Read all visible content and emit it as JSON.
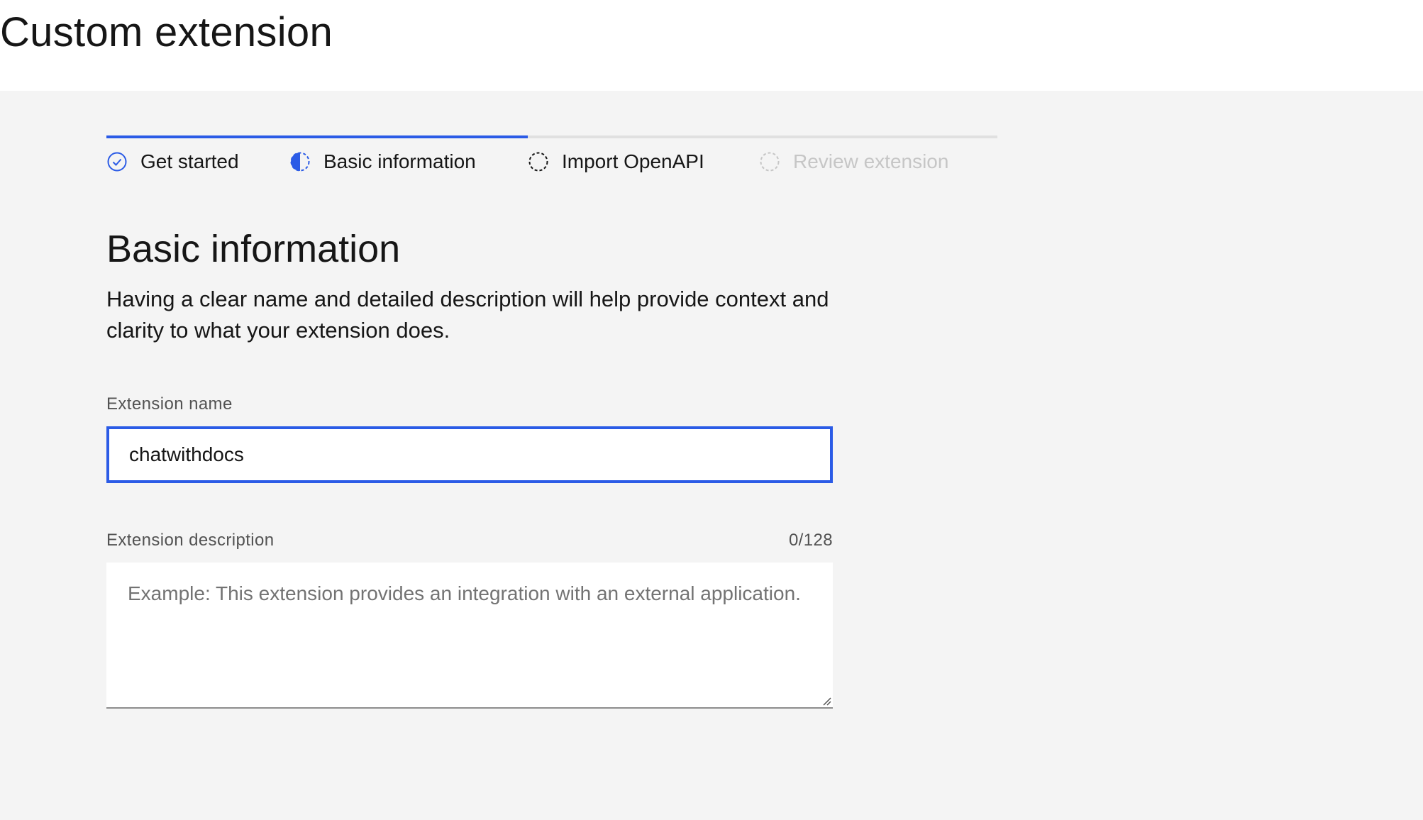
{
  "page": {
    "title": "Custom extension"
  },
  "progress": {
    "current_step": 2,
    "steps": [
      {
        "label": "Get started",
        "state": "complete",
        "icon": "checkmark-circle-icon"
      },
      {
        "label": "Basic information",
        "state": "current",
        "icon": "half-circle-icon"
      },
      {
        "label": "Import OpenAPI",
        "state": "incomplete",
        "icon": "dashed-circle-icon"
      },
      {
        "label": "Review extension",
        "state": "disabled",
        "icon": "dashed-circle-icon"
      }
    ]
  },
  "section": {
    "title": "Basic information",
    "description": "Having a clear name and detailed description will help provide context and clarity to what your extension does."
  },
  "form": {
    "name_label": "Extension name",
    "name_value": "chatwithdocs",
    "description_label": "Extension description",
    "description_counter": "0/128",
    "description_value": "",
    "description_placeholder": "Example: This extension provides an integration with an external application."
  },
  "colors": {
    "accent": "#2b5be6",
    "background": "#f4f4f4",
    "text": "#161616",
    "muted": "#525252",
    "disabled": "#c6c6c6"
  }
}
